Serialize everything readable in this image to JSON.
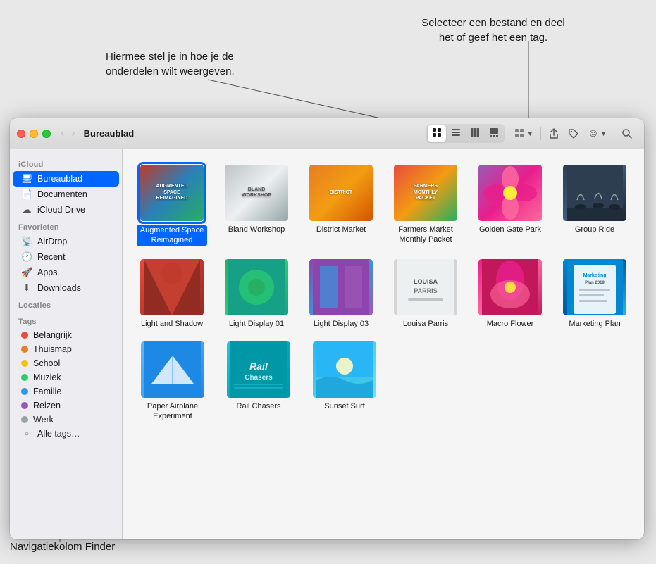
{
  "annotations": {
    "top_right": {
      "line1": "Selecteer een bestand en deel",
      "line2": "het of geef het een tag."
    },
    "top_left": {
      "line1": "Hiermee stel je in hoe je de",
      "line2": "onderdelen wilt weergeven."
    },
    "bottom_left": "Navigatiekolom Finder"
  },
  "window": {
    "title": "Bureaublad",
    "nav": {
      "back_label": "‹",
      "forward_label": "›"
    },
    "toolbar": {
      "view_icon": "⊞",
      "list_icon": "≡",
      "column_icon": "⫿",
      "gallery_icon": "⬚",
      "group_label": "⊞",
      "share_label": "↑",
      "tag_label": "🏷",
      "more_label": "☺",
      "search_label": "🔍"
    }
  },
  "sidebar": {
    "sections": [
      {
        "label": "iCloud",
        "items": [
          {
            "icon": "desktop",
            "label": "Bureaublad",
            "active": true
          },
          {
            "icon": "doc",
            "label": "Documenten",
            "active": false
          },
          {
            "icon": "cloud",
            "label": "iCloud Drive",
            "active": false
          }
        ]
      },
      {
        "label": "Favorieten",
        "items": [
          {
            "icon": "airdrop",
            "label": "AirDrop",
            "active": false
          },
          {
            "icon": "clock",
            "label": "Recent",
            "active": false
          },
          {
            "icon": "apps",
            "label": "Apps",
            "active": false
          },
          {
            "icon": "download",
            "label": "Downloads",
            "active": false
          }
        ]
      },
      {
        "label": "Locaties",
        "items": []
      },
      {
        "label": "Tags",
        "items": [
          {
            "color": "#e74c3c",
            "label": "Belangrijk"
          },
          {
            "color": "#e67e22",
            "label": "Thuismap"
          },
          {
            "color": "#f1c40f",
            "label": "School"
          },
          {
            "color": "#2ecc71",
            "label": "Muziek"
          },
          {
            "color": "#3498db",
            "label": "Familie"
          },
          {
            "color": "#9b59b6",
            "label": "Reizen"
          },
          {
            "color": "#95a5a6",
            "label": "Werk"
          },
          {
            "color": "#bdc3c7",
            "label": "Alle tags…"
          }
        ]
      }
    ]
  },
  "files": {
    "rows": [
      [
        {
          "id": "augmented",
          "label": "Augmented Space Reimagined",
          "selected": true,
          "thumb_class": "thumb-augmented",
          "thumb_text": "AUGMENTED SPACE REIMAGINED"
        },
        {
          "id": "bland",
          "label": "Bland Workshop",
          "selected": false,
          "thumb_class": "thumb-bland",
          "thumb_text": "BLAND WORKSHOP"
        },
        {
          "id": "district",
          "label": "District Market",
          "selected": false,
          "thumb_class": "thumb-district",
          "thumb_text": "DISTRICT"
        },
        {
          "id": "farmers",
          "label": "Farmers Market Monthly Packet",
          "selected": false,
          "thumb_class": "thumb-farmers",
          "thumb_text": "FARMERS MONTHLY PACKET"
        },
        {
          "id": "golden",
          "label": "Golden Gate Park",
          "selected": false,
          "thumb_class": "thumb-golden",
          "thumb_text": ""
        },
        {
          "id": "group",
          "label": "Group Ride",
          "selected": false,
          "thumb_class": "thumb-group",
          "thumb_text": ""
        }
      ],
      [
        {
          "id": "light-shadow",
          "label": "Light and Shadow",
          "selected": false,
          "thumb_class": "thumb-light-shadow",
          "thumb_text": ""
        },
        {
          "id": "light01",
          "label": "Light Display 01",
          "selected": false,
          "thumb_class": "thumb-light01",
          "thumb_text": ""
        },
        {
          "id": "light03",
          "label": "Light Display 03",
          "selected": false,
          "thumb_class": "thumb-light03",
          "thumb_text": ""
        },
        {
          "id": "louisa",
          "label": "Louisa Parris",
          "selected": false,
          "thumb_class": "thumb-louisa",
          "thumb_text": ""
        },
        {
          "id": "macro",
          "label": "Macro Flower",
          "selected": false,
          "thumb_class": "thumb-macro",
          "thumb_text": ""
        },
        {
          "id": "marketing",
          "label": "Marketing Plan",
          "selected": false,
          "thumb_class": "thumb-marketing",
          "thumb_text": ""
        }
      ],
      [
        {
          "id": "paper",
          "label": "Paper Airplane Experiment",
          "selected": false,
          "thumb_class": "thumb-paper",
          "thumb_text": ""
        },
        {
          "id": "rail",
          "label": "Rail Chasers",
          "selected": false,
          "thumb_class": "thumb-rail",
          "thumb_text": ""
        },
        {
          "id": "sunset",
          "label": "Sunset Surf",
          "selected": false,
          "thumb_class": "thumb-sunset",
          "thumb_text": ""
        }
      ]
    ]
  }
}
